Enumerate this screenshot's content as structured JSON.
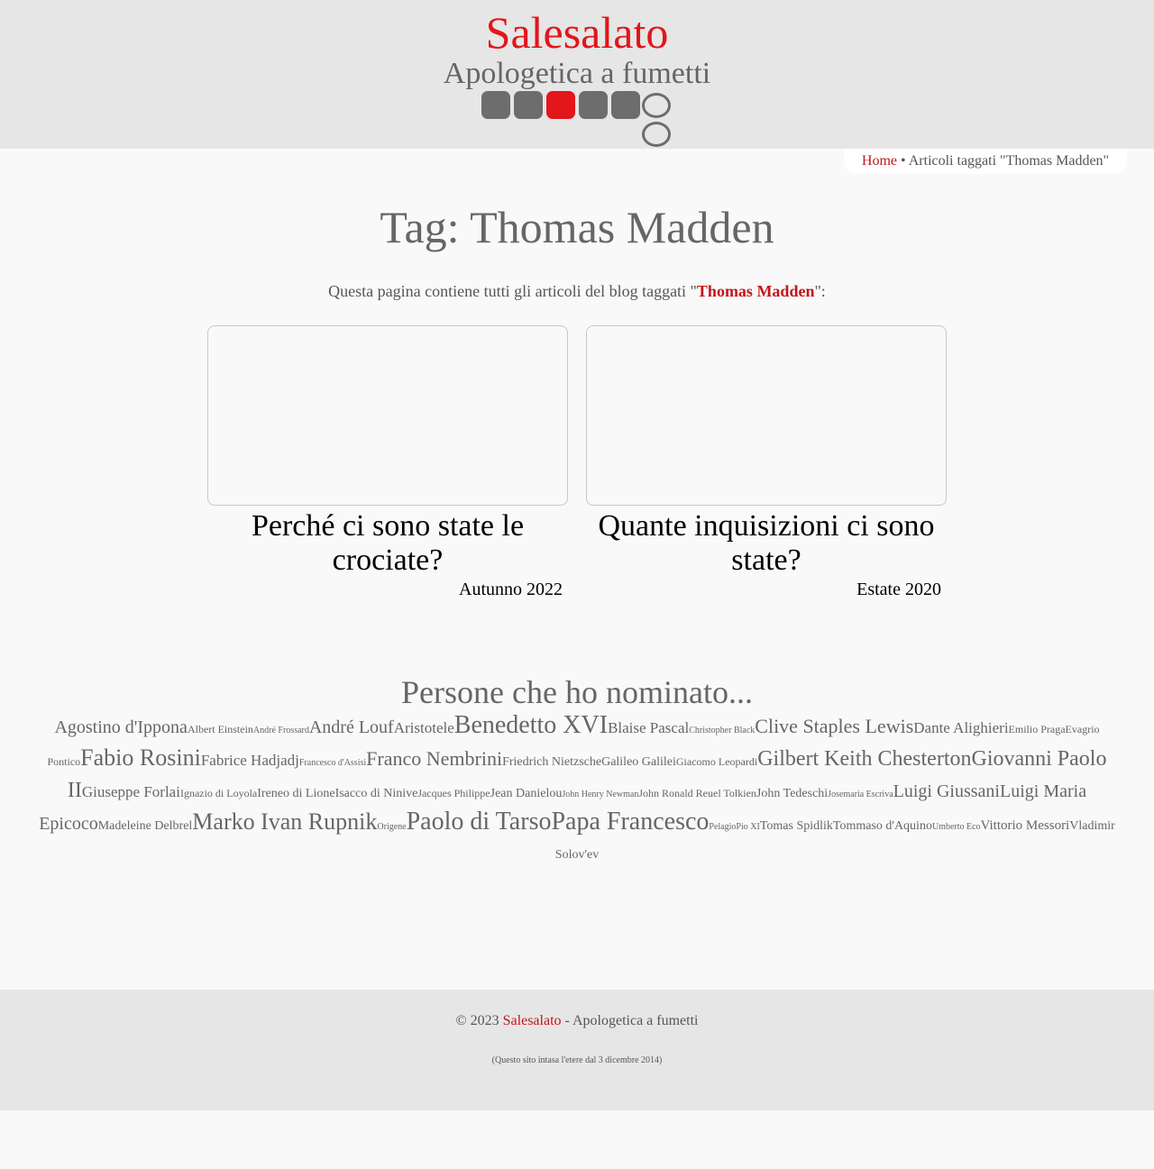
{
  "header": {
    "site_title": "Salesalato",
    "subtitle": "Apologetica a fumetti",
    "accent_color": "#e2161b"
  },
  "menu": {
    "active_index": 2,
    "buttons": [
      "menu-button-1",
      "menu-button-2",
      "menu-button-3",
      "menu-button-4",
      "menu-button-5"
    ]
  },
  "breadcrumb": {
    "home": "Home",
    "separator": " • ",
    "current": "Articoli taggati \"Thomas Madden\""
  },
  "page": {
    "title": "Tag: Thomas Madden",
    "intro_before": "Questa pagina contiene tutti gli articoli del blog taggati \"",
    "intro_tag": "Thomas Madden",
    "intro_after": "\":"
  },
  "articles": [
    {
      "title": "Perché ci sono state le crociate?",
      "date": "Autunno 2022"
    },
    {
      "title": "Quante inquisizioni ci sono state?",
      "date": "Estate 2020"
    }
  ],
  "tag_cloud": {
    "title": "Persone che ho nominato...",
    "tags": [
      {
        "name": "Agostino d'Ippona",
        "size": 20
      },
      {
        "name": "Albert Einstein",
        "size": 12
      },
      {
        "name": "André Frossard",
        "size": 10
      },
      {
        "name": "André Louf",
        "size": 20
      },
      {
        "name": "Aristotele",
        "size": 17
      },
      {
        "name": "Benedetto XVI",
        "size": 28
      },
      {
        "name": "Blaise Pascal",
        "size": 17
      },
      {
        "name": "Christopher Black",
        "size": 10
      },
      {
        "name": "Clive Staples Lewis",
        "size": 22
      },
      {
        "name": "Dante Alighieri",
        "size": 17
      },
      {
        "name": "Emilio Praga",
        "size": 12
      },
      {
        "name": "Evagrio Pontico",
        "size": 12
      },
      {
        "name": "Fabio Rosini",
        "size": 26
      },
      {
        "name": "Fabrice Hadjadj",
        "size": 17
      },
      {
        "name": "Francesco d'Assisi",
        "size": 10
      },
      {
        "name": "Franco Nembrini",
        "size": 22
      },
      {
        "name": "Friedrich Nietzsche",
        "size": 14
      },
      {
        "name": "Galileo Galilei",
        "size": 14
      },
      {
        "name": "Giacomo Leopardi",
        "size": 12
      },
      {
        "name": "Gilbert Keith Chesterton",
        "size": 24
      },
      {
        "name": "Giovanni Paolo II",
        "size": 24
      },
      {
        "name": "Giuseppe Forlai",
        "size": 17
      },
      {
        "name": "Ignazio di Loyola",
        "size": 12
      },
      {
        "name": "Ireneo di Lione",
        "size": 14
      },
      {
        "name": "Isacco di Ninive",
        "size": 14
      },
      {
        "name": "Jacques Philippe",
        "size": 12
      },
      {
        "name": "Jean Danielou",
        "size": 14
      },
      {
        "name": "John Henry Newman",
        "size": 10
      },
      {
        "name": "John Ronald Reuel Tolkien",
        "size": 12
      },
      {
        "name": "John Tedeschi",
        "size": 14
      },
      {
        "name": "Josemaria Escriva",
        "size": 10
      },
      {
        "name": "Luigi Giussani",
        "size": 20
      },
      {
        "name": "Luigi Maria Epicoco",
        "size": 20
      },
      {
        "name": "Madeleine Delbrel",
        "size": 14
      },
      {
        "name": "Marko Ivan Rupnik",
        "size": 26
      },
      {
        "name": "Origene",
        "size": 10
      },
      {
        "name": "Paolo di Tarso",
        "size": 28
      },
      {
        "name": "Papa Francesco",
        "size": 28
      },
      {
        "name": "Pelagio",
        "size": 10
      },
      {
        "name": "Pio XI",
        "size": 10
      },
      {
        "name": "Tomas Spidlik",
        "size": 14
      },
      {
        "name": "Tommaso d'Aquino",
        "size": 14
      },
      {
        "name": "Umberto Eco",
        "size": 10
      },
      {
        "name": "Vittorio Messori",
        "size": 15
      },
      {
        "name": "Vladimir Solov'ev",
        "size": 14
      }
    ]
  },
  "footer": {
    "copyright_prefix": "© 2023 ",
    "copyright_link": "Salesalato",
    "copyright_suffix": " - Apologetica a fumetti",
    "since": "(Questo sito intasa l'etere dal 3 dicembre 2014)"
  }
}
